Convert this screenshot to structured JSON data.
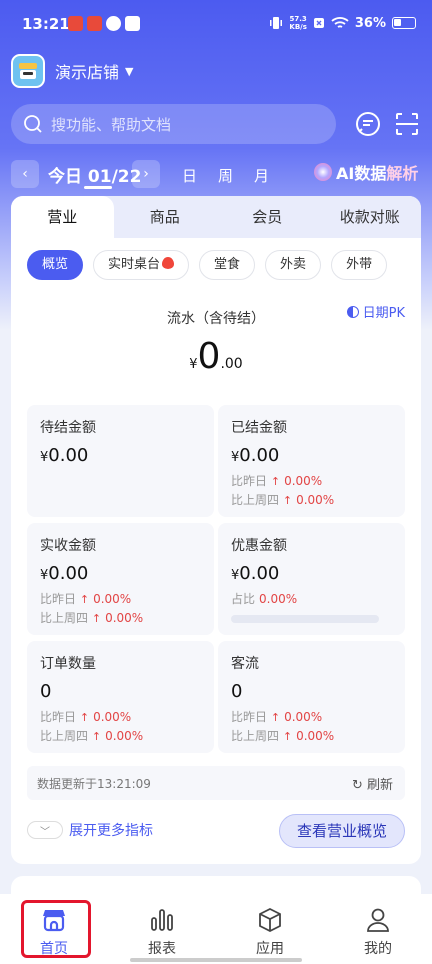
{
  "status_bar": {
    "time": "13:21",
    "net_speed_value": "57.3",
    "net_speed_unit": "KB/s",
    "battery": "36%"
  },
  "shop": {
    "name": "演示店铺"
  },
  "search": {
    "placeholder": "搜功能、帮助文档"
  },
  "date_bar": {
    "date": "今日 01/22",
    "periods": [
      "日",
      "周",
      "月"
    ],
    "ai_prefix": "AI数据",
    "ai_suffix": "解析"
  },
  "tabs": [
    "营业",
    "商品",
    "会员",
    "收款对账"
  ],
  "chips": [
    "概览",
    "实时桌台",
    "堂食",
    "外卖",
    "外带"
  ],
  "flow": {
    "label": "流水（含待结）",
    "currency": "¥",
    "integer": "0",
    "decimal": ".00",
    "pk_label": "日期PK"
  },
  "metrics": [
    {
      "label": "待结金额",
      "value": "0.00",
      "has_currency": true,
      "comparisons": []
    },
    {
      "label": "已结金额",
      "value": "0.00",
      "has_currency": true,
      "comparisons": [
        {
          "label": "比昨日",
          "value": "0.00%"
        },
        {
          "label": "比上周四",
          "value": "0.00%"
        }
      ]
    },
    {
      "label": "实收金额",
      "value": "0.00",
      "has_currency": true,
      "comparisons": [
        {
          "label": "比昨日",
          "value": "0.00%"
        },
        {
          "label": "比上周四",
          "value": "0.00%"
        }
      ]
    },
    {
      "label": "优惠金额",
      "value": "0.00",
      "has_currency": true,
      "share": {
        "label": "占比",
        "value": "0.00%"
      }
    },
    {
      "label": "订单数量",
      "value": "0",
      "has_currency": false,
      "comparisons": [
        {
          "label": "比昨日",
          "value": "0.00%"
        },
        {
          "label": "比上周四",
          "value": "0.00%"
        }
      ]
    },
    {
      "label": "客流",
      "value": "0",
      "has_currency": false,
      "comparisons": [
        {
          "label": "比昨日",
          "value": "0.00%"
        },
        {
          "label": "比上周四",
          "value": "0.00%"
        }
      ]
    }
  ],
  "currency_symbol": "¥",
  "update": {
    "text": "数据更新于13:21:09",
    "refresh": "刷新"
  },
  "expand": {
    "label": "展开更多指标"
  },
  "overview_button": {
    "label": "查看营业概览"
  },
  "nav": [
    {
      "label": "首页",
      "icon": "home-store-icon",
      "active": true
    },
    {
      "label": "报表",
      "icon": "bar-chart-icon",
      "active": false
    },
    {
      "label": "应用",
      "icon": "cube-icon",
      "active": false
    },
    {
      "label": "我的",
      "icon": "user-icon",
      "active": false
    }
  ],
  "colors": {
    "primary": "#4b5cf0",
    "up_red": "#e24545",
    "highlight": "#e3162d"
  }
}
